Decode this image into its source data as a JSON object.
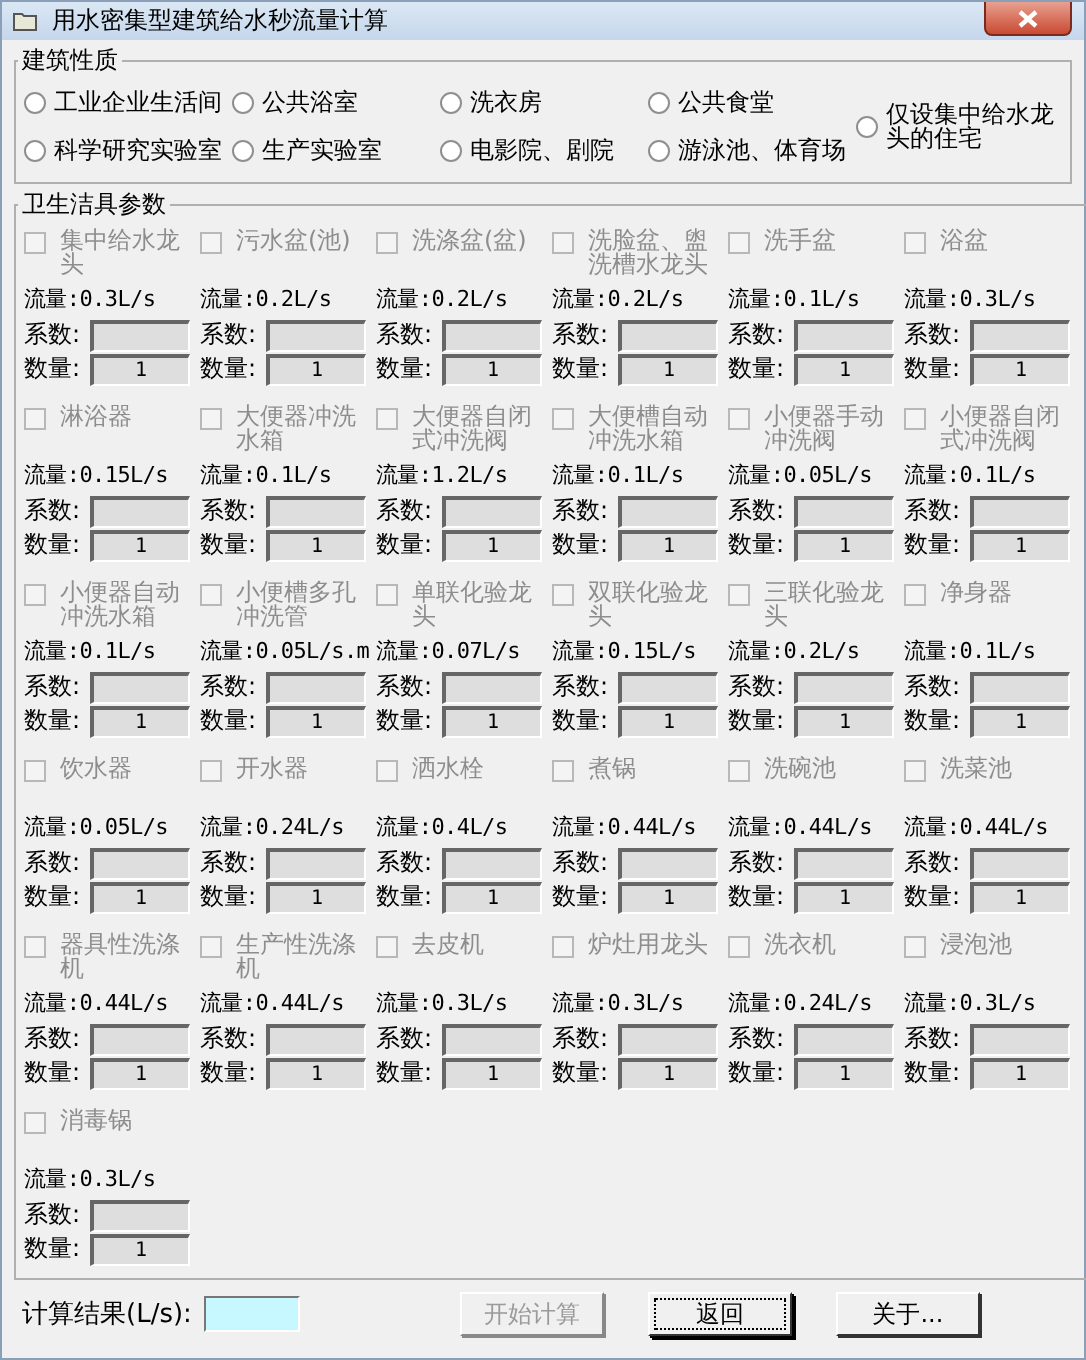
{
  "window": {
    "title": "用水密集型建筑给水秒流量计算"
  },
  "building_type": {
    "title": "建筑性质",
    "options": [
      {
        "label": "工业企业生活间",
        "selected": false
      },
      {
        "label": "公共浴室",
        "selected": false
      },
      {
        "label": "洗衣房",
        "selected": false
      },
      {
        "label": "公共食堂",
        "selected": false
      },
      {
        "label": "仅设集中给水龙头的住宅",
        "selected": false
      },
      {
        "label": "科学研究实验室",
        "selected": false
      },
      {
        "label": "生产实验室",
        "selected": false
      },
      {
        "label": "电影院、剧院",
        "selected": false
      },
      {
        "label": "游泳池、体育场",
        "selected": false
      }
    ]
  },
  "fixtures": {
    "title": "卫生洁具参数",
    "items": [
      {
        "name": "集中给水龙头",
        "checked": false,
        "disabled": true,
        "flow": "流量:0.3L/s",
        "coef_label": "系数:",
        "count_label": "数量:",
        "count": "1"
      },
      {
        "name": "污水盆(池)",
        "checked": false,
        "disabled": true,
        "flow": "流量:0.2L/s",
        "coef_label": "系数:",
        "count_label": "数量:",
        "count": "1"
      },
      {
        "name": "洗涤盆(盆)",
        "checked": false,
        "disabled": true,
        "flow": "流量:0.2L/s",
        "coef_label": "系数:",
        "count_label": "数量:",
        "count": "1"
      },
      {
        "name": "洗脸盆、盥洗槽水龙头",
        "checked": false,
        "disabled": true,
        "flow": "流量:0.2L/s",
        "coef_label": "系数:",
        "count_label": "数量:",
        "count": "1"
      },
      {
        "name": "洗手盆",
        "checked": false,
        "disabled": true,
        "flow": "流量:0.1L/s",
        "coef_label": "系数:",
        "count_label": "数量:",
        "count": "1"
      },
      {
        "name": "浴盆",
        "checked": false,
        "disabled": true,
        "flow": "流量:0.3L/s",
        "coef_label": "系数:",
        "count_label": "数量:",
        "count": "1"
      },
      {
        "name": "淋浴器",
        "checked": false,
        "disabled": true,
        "flow": "流量:0.15L/s",
        "coef_label": "系数:",
        "count_label": "数量:",
        "count": "1"
      },
      {
        "name": "大便器冲洗水箱",
        "checked": false,
        "disabled": true,
        "flow": "流量:0.1L/s",
        "coef_label": "系数:",
        "count_label": "数量:",
        "count": "1"
      },
      {
        "name": "大便器自闭式冲洗阀",
        "checked": false,
        "disabled": true,
        "flow": "流量:1.2L/s",
        "coef_label": "系数:",
        "count_label": "数量:",
        "count": "1"
      },
      {
        "name": "大便槽自动冲洗水箱",
        "checked": false,
        "disabled": true,
        "flow": "流量:0.1L/s",
        "coef_label": "系数:",
        "count_label": "数量:",
        "count": "1"
      },
      {
        "name": "小便器手动冲洗阀",
        "checked": false,
        "disabled": true,
        "flow": "流量:0.05L/s",
        "coef_label": "系数:",
        "count_label": "数量:",
        "count": "1"
      },
      {
        "name": "小便器自闭式冲洗阀",
        "checked": false,
        "disabled": true,
        "flow": "流量:0.1L/s",
        "coef_label": "系数:",
        "count_label": "数量:",
        "count": "1"
      },
      {
        "name": "小便器自动冲洗水箱",
        "checked": false,
        "disabled": true,
        "flow": "流量:0.1L/s",
        "coef_label": "系数:",
        "count_label": "数量:",
        "count": "1"
      },
      {
        "name": "小便槽多孔冲洗管",
        "checked": false,
        "disabled": true,
        "flow": "流量:0.05L/s.m",
        "coef_label": "系数:",
        "count_label": "数量:",
        "count": "1"
      },
      {
        "name": "单联化验龙头",
        "checked": false,
        "disabled": true,
        "flow": "流量:0.07L/s",
        "coef_label": "系数:",
        "count_label": "数量:",
        "count": "1"
      },
      {
        "name": "双联化验龙头",
        "checked": false,
        "disabled": true,
        "flow": "流量:0.15L/s",
        "coef_label": "系数:",
        "count_label": "数量:",
        "count": "1"
      },
      {
        "name": "三联化验龙头",
        "checked": false,
        "disabled": true,
        "flow": "流量:0.2L/s",
        "coef_label": "系数:",
        "count_label": "数量:",
        "count": "1"
      },
      {
        "name": "净身器",
        "checked": false,
        "disabled": true,
        "flow": "流量:0.1L/s",
        "coef_label": "系数:",
        "count_label": "数量:",
        "count": "1"
      },
      {
        "name": "饮水器",
        "checked": false,
        "disabled": true,
        "flow": "流量:0.05L/s",
        "coef_label": "系数:",
        "count_label": "数量:",
        "count": "1"
      },
      {
        "name": "开水器",
        "checked": false,
        "disabled": true,
        "flow": "流量:0.24L/s",
        "coef_label": "系数:",
        "count_label": "数量:",
        "count": "1"
      },
      {
        "name": "洒水栓",
        "checked": false,
        "disabled": true,
        "flow": "流量:0.4L/s",
        "coef_label": "系数:",
        "count_label": "数量:",
        "count": "1"
      },
      {
        "name": "煮锅",
        "checked": false,
        "disabled": true,
        "flow": "流量:0.44L/s",
        "coef_label": "系数:",
        "count_label": "数量:",
        "count": "1"
      },
      {
        "name": "洗碗池",
        "checked": false,
        "disabled": true,
        "flow": "流量:0.44L/s",
        "coef_label": "系数:",
        "count_label": "数量:",
        "count": "1"
      },
      {
        "name": "洗菜池",
        "checked": false,
        "disabled": true,
        "flow": "流量:0.44L/s",
        "coef_label": "系数:",
        "count_label": "数量:",
        "count": "1"
      },
      {
        "name": "器具性洗涤机",
        "checked": false,
        "disabled": true,
        "flow": "流量:0.44L/s",
        "coef_label": "系数:",
        "count_label": "数量:",
        "count": "1"
      },
      {
        "name": "生产性洗涤机",
        "checked": false,
        "disabled": true,
        "flow": "流量:0.44L/s",
        "coef_label": "系数:",
        "count_label": "数量:",
        "count": "1"
      },
      {
        "name": "去皮机",
        "checked": false,
        "disabled": true,
        "flow": "流量:0.3L/s",
        "coef_label": "系数:",
        "count_label": "数量:",
        "count": "1"
      },
      {
        "name": "炉灶用龙头",
        "checked": false,
        "disabled": true,
        "flow": "流量:0.3L/s",
        "coef_label": "系数:",
        "count_label": "数量:",
        "count": "1"
      },
      {
        "name": "洗衣机",
        "checked": false,
        "disabled": true,
        "flow": "流量:0.24L/s",
        "coef_label": "系数:",
        "count_label": "数量:",
        "count": "1"
      },
      {
        "name": "浸泡池",
        "checked": false,
        "disabled": true,
        "flow": "流量:0.3L/s",
        "coef_label": "系数:",
        "count_label": "数量:",
        "count": "1"
      },
      {
        "name": "消毒锅",
        "checked": false,
        "disabled": true,
        "flow": "流量:0.3L/s",
        "coef_label": "系数:",
        "count_label": "数量:",
        "count": "1"
      }
    ]
  },
  "result": {
    "label": "计算结果(L/s):"
  },
  "buttons": [
    {
      "label": "开始计算",
      "disabled": true,
      "focused": false
    },
    {
      "label": "返回",
      "disabled": false,
      "focused": true
    },
    {
      "label": "关于...",
      "disabled": false,
      "focused": false
    }
  ]
}
